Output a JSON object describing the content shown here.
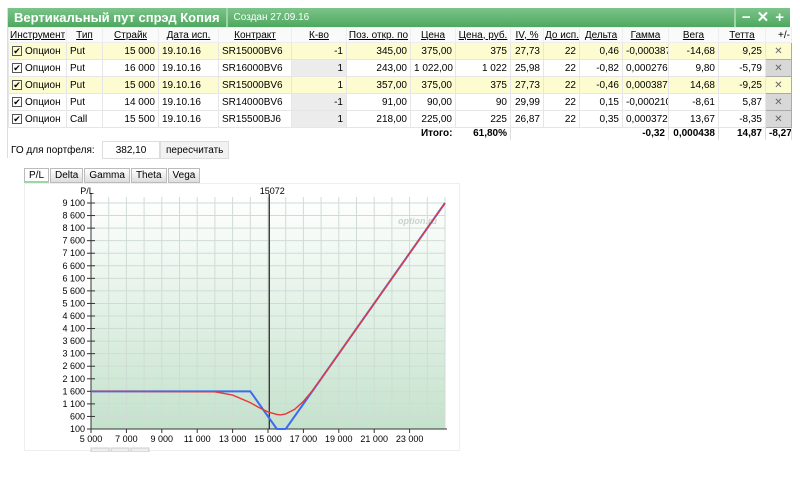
{
  "window": {
    "title": "Вертикальный пут спрэд Копия",
    "created": "Создан 27.09.16",
    "controls": [
      "−",
      "✕",
      "+"
    ]
  },
  "table": {
    "headers": [
      "Инструмент",
      "Тип",
      "Страйк",
      "Дата исп.",
      "Контракт",
      "К-во",
      "Поз. откр. по",
      "Цена",
      "Цена, руб.",
      "IV, %",
      "До исп.",
      "Дельта",
      "Гамма",
      "Вега",
      "Тетта",
      "+/-"
    ],
    "rows": [
      {
        "checked": true,
        "highlight": true,
        "cells": [
          "Опцион",
          "Put",
          "15 000",
          "19.10.16",
          "SR15000BV6",
          "-1",
          "345,00",
          "375,00",
          "375",
          "27,73",
          "22",
          "0,46",
          "-0,000387",
          "-14,68",
          "9,25"
        ]
      },
      {
        "checked": true,
        "highlight": false,
        "cells": [
          "Опцион",
          "Put",
          "16 000",
          "19.10.16",
          "SR16000BV6",
          "1",
          "243,00",
          "1 022,00",
          "1 022",
          "25,98",
          "22",
          "-0,82",
          "0,000276",
          "9,80",
          "-5,79"
        ]
      },
      {
        "checked": true,
        "highlight": true,
        "cells": [
          "Опцион",
          "Put",
          "15 000",
          "19.10.16",
          "SR15000BV6",
          "1",
          "357,00",
          "375,00",
          "375",
          "27,73",
          "22",
          "-0,46",
          "0,000387",
          "14,68",
          "-9,25"
        ]
      },
      {
        "checked": true,
        "highlight": false,
        "cells": [
          "Опцион",
          "Put",
          "14 000",
          "19.10.16",
          "SR14000BV6",
          "-1",
          "91,00",
          "90,00",
          "90",
          "29,99",
          "22",
          "0,15",
          "-0,000210",
          "-8,61",
          "5,87"
        ]
      },
      {
        "checked": true,
        "highlight": false,
        "cells": [
          "Опцион",
          "Call",
          "15 500",
          "19.10.16",
          "SR15500BJ6",
          "1",
          "218,00",
          "225,00",
          "225",
          "26,87",
          "22",
          "0,35",
          "0,000372",
          "13,67",
          "-8,35"
        ]
      }
    ],
    "totals": {
      "label": "Итого:",
      "pct": "61,80%",
      "delta": "-0,32",
      "gamma": "0,000438",
      "vega": "14,87",
      "theta": "-8,27"
    }
  },
  "margin": {
    "label": "ГО для портфеля:",
    "value": "382,10",
    "button": "пересчитать"
  },
  "chart_tabs": [
    "P/L",
    "Delta",
    "Gamma",
    "Theta",
    "Vega"
  ],
  "chart_data": {
    "type": "line",
    "ylabel": "P/L",
    "watermark": "option.ru",
    "marker": {
      "x": 15072,
      "label": "15072"
    },
    "xlim": [
      5000,
      25000
    ],
    "ylim": [
      100,
      9100
    ],
    "xticks": [
      5000,
      7000,
      9000,
      11000,
      13000,
      15000,
      17000,
      19000,
      21000,
      23000
    ],
    "xtick_labels": [
      "5 000",
      "7 000",
      "9 000",
      "11 000",
      "13 000",
      "15 000",
      "17 000",
      "19 000",
      "21 000",
      "23 000"
    ],
    "yticks": [
      100,
      600,
      1100,
      1600,
      2100,
      2600,
      3100,
      3600,
      4100,
      4600,
      5100,
      5600,
      6100,
      6600,
      7100,
      7600,
      8100,
      8600,
      9100
    ],
    "ytick_labels": [
      "100",
      "600",
      "1 100",
      "1 600",
      "2 100",
      "2 600",
      "3 100",
      "3 600",
      "4 100",
      "4 600",
      "5 100",
      "5 600",
      "6 100",
      "6 600",
      "7 100",
      "7 600",
      "8 100",
      "8 600",
      "9 100"
    ],
    "grid": true,
    "series": [
      {
        "color": "#3b6cf0",
        "x": [
          5000,
          14000,
          15500,
          16000,
          25000
        ],
        "y": [
          1600,
          1600,
          100,
          100,
          9100
        ]
      },
      {
        "color": "#e83838",
        "x": [
          5000,
          12000,
          13000,
          14000,
          14500,
          15000,
          15500,
          15700,
          16000,
          16500,
          17000,
          17500,
          18000,
          25000
        ],
        "y": [
          1600,
          1580,
          1450,
          1150,
          950,
          780,
          680,
          660,
          700,
          880,
          1200,
          1620,
          2100,
          9100
        ]
      }
    ]
  }
}
